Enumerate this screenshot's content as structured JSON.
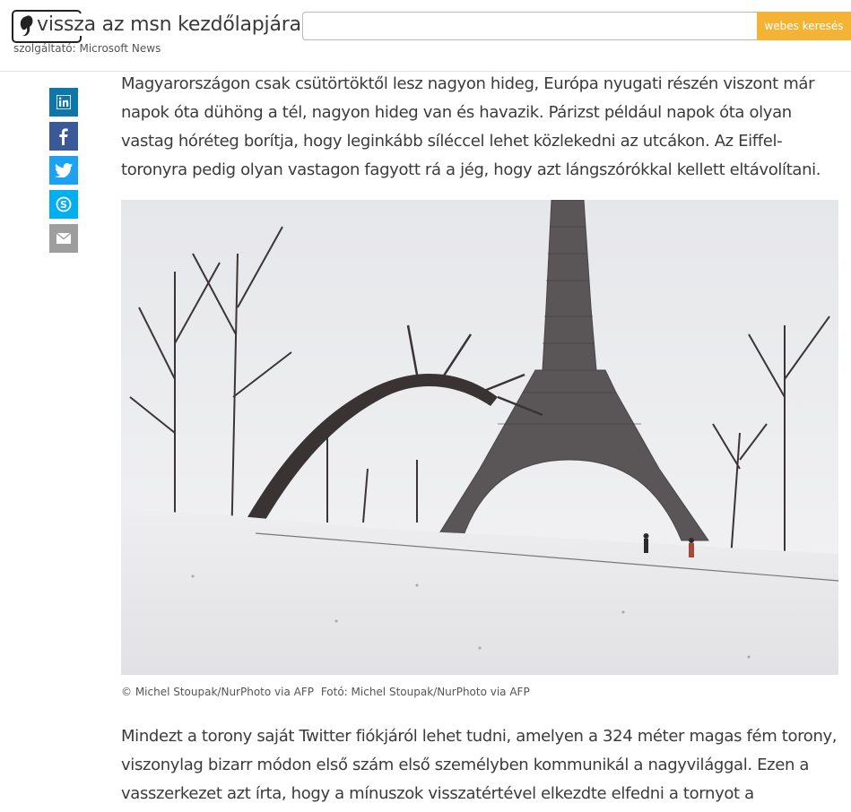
{
  "header": {
    "back_link": "vissza az msn kezdőlapjára",
    "provider": "szolgáltató: Microsoft News",
    "search": {
      "placeholder": "",
      "value": "",
      "button_label": "webes keresés"
    }
  },
  "share": [
    {
      "icon": "linkedin-icon",
      "color": "#0e76a8",
      "glyph": "in"
    },
    {
      "icon": "facebook-icon",
      "color": "#3b5998",
      "glyph": "f"
    },
    {
      "icon": "twitter-icon",
      "color": "#1da1f2"
    },
    {
      "icon": "skype-icon",
      "color": "#00aff0"
    },
    {
      "icon": "mail-icon",
      "color": "#9e9e9e"
    }
  ],
  "article": {
    "paragraph_1": "Magyarországon csak csütörtöktől lesz nagyon hideg, Európa nyugati részén viszont már napok óta dühöng a tél, nagyon hideg van és havazik. Párizst például napok óta olyan vastag hóréteg borítja, hogy leginkább síléccel lehet közlekedni az utcákon. Az Eiffel-toronyra pedig olyan vastagon fagyott rá a jég, hogy azt lángszórókkal kellett eltávolítani.",
    "photo_credit": "© Michel Stoupak/NurPhoto via AFP",
    "photo_source": "Fotó: Michel Stoupak/NurPhoto via AFP",
    "paragraph_2": "Mindezt a torony saját Twitter fiókjáról lehet tudni, amelyen a 324 méter magas fém torony, viszonylag bizarr módon első szám első személyben kommunikál a nagyvilággal. Ezen a vasszerkezet azt írta, hogy a mínuszok visszatértével elkezdte elfedni a tornyot a"
  }
}
